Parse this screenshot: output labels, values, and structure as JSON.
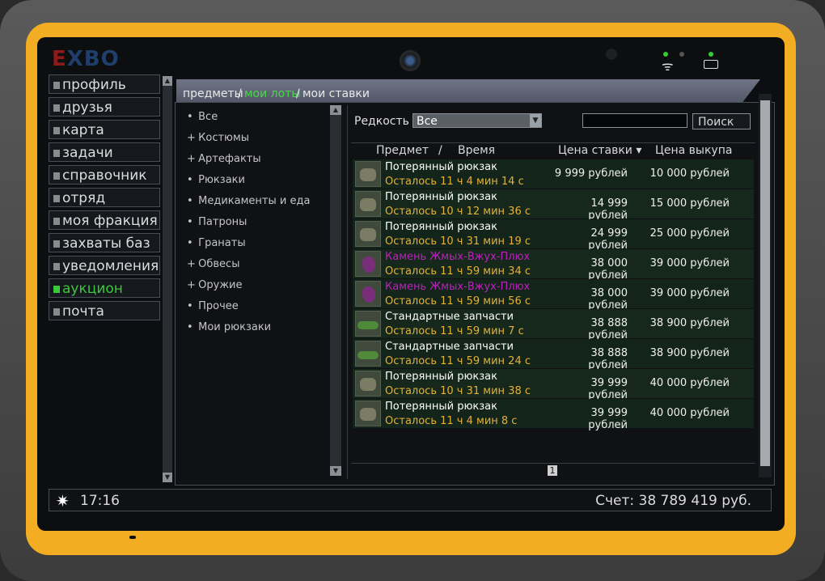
{
  "logo": {
    "text_r": "E",
    "text_rest": "XBO"
  },
  "menu": {
    "items": [
      {
        "label": "профиль",
        "active": false
      },
      {
        "label": "друзья",
        "active": false
      },
      {
        "label": "карта",
        "active": false
      },
      {
        "label": "задачи",
        "active": false
      },
      {
        "label": "справочник",
        "active": false
      },
      {
        "label": "отряд",
        "active": false
      },
      {
        "label": "моя фракция",
        "active": false
      },
      {
        "label": "захваты баз",
        "active": false
      },
      {
        "label": "уведомления",
        "active": false
      },
      {
        "label": "аукцион",
        "active": true
      },
      {
        "label": "почта",
        "active": false
      }
    ]
  },
  "tabs": {
    "items": "предметы",
    "lots": "мои лоты",
    "bids": "мои ставки",
    "sep": "/"
  },
  "categories": [
    {
      "prefix": "•",
      "label": "Все"
    },
    {
      "prefix": "+",
      "label": "Костюмы"
    },
    {
      "prefix": "+",
      "label": "Артефакты"
    },
    {
      "prefix": "•",
      "label": "Рюкзаки"
    },
    {
      "prefix": "•",
      "label": "Медикаменты и еда"
    },
    {
      "prefix": "•",
      "label": "Патроны"
    },
    {
      "prefix": "•",
      "label": "Гранаты"
    },
    {
      "prefix": "+",
      "label": "Обвесы"
    },
    {
      "prefix": "+",
      "label": "Оружие"
    },
    {
      "prefix": "•",
      "label": "Прочее"
    },
    {
      "prefix": "•",
      "label": "Мои рюкзаки"
    }
  ],
  "filter": {
    "rarity_label": "Редкость",
    "rarity_value": "Все",
    "search_button": "Поиск",
    "search_value": ""
  },
  "table": {
    "headers": {
      "item": "Предмет",
      "sep": "/",
      "time": "Время",
      "bid": "Цена ставки ▾",
      "buyout": "Цена выкупа"
    },
    "rows": [
      {
        "icon": "backpack-icon",
        "name": "Потерянный рюкзак",
        "name_color": "white",
        "time": "Осталось 11 ч 4 мин 14 с",
        "bid": "9 999 рублей",
        "buyout": "10 000 рублей"
      },
      {
        "icon": "backpack-icon",
        "name": "Потерянный рюкзак",
        "name_color": "white",
        "time": "Осталось 10 ч 12 мин 36 с",
        "bid": "14 999 рублей",
        "buyout": "15 000 рублей"
      },
      {
        "icon": "backpack-icon",
        "name": "Потерянный рюкзак",
        "name_color": "white",
        "time": "Осталось 10 ч 31 мин 19 с",
        "bid": "24 999 рублей",
        "buyout": "25 000 рублей"
      },
      {
        "icon": "stone-icon",
        "name": "Камень Жмых-Вжух-Плюх",
        "name_color": "magenta",
        "time": "Осталось 11 ч 59 мин 34 с",
        "bid": "38 000 рублей",
        "buyout": "39 000 рублей"
      },
      {
        "icon": "stone-icon",
        "name": "Камень Жмых-Вжух-Плюх",
        "name_color": "magenta",
        "time": "Осталось 11 ч 59 мин 56 с",
        "bid": "38 000 рублей",
        "buyout": "39 000 рублей"
      },
      {
        "icon": "parts-icon",
        "name": "Стандартные запчасти",
        "name_color": "white",
        "time": "Осталось 11 ч 59 мин 7 с",
        "bid": "38 888 рублей",
        "buyout": "38 900 рублей"
      },
      {
        "icon": "parts-icon",
        "name": "Стандартные запчасти",
        "name_color": "white",
        "time": "Осталось 11 ч 59 мин 24 с",
        "bid": "38 888 рублей",
        "buyout": "38 900 рублей"
      },
      {
        "icon": "backpack-icon",
        "name": "Потерянный рюкзак",
        "name_color": "white",
        "time": "Осталось 10 ч 31 мин 38 с",
        "bid": "39 999 рублей",
        "buyout": "40 000 рублей"
      },
      {
        "icon": "backpack-icon",
        "name": "Потерянный рюкзак",
        "name_color": "white",
        "time": "Осталось 11 ч 4 мин 8 с",
        "bid": "39 999 рублей",
        "buyout": "40 000 рублей"
      }
    ],
    "page": "1"
  },
  "status": {
    "time": "17:16",
    "balance": "Счет: 38 789 419 руб."
  },
  "colors": {
    "accent_green": "#3cc83c",
    "time_gold": "#e2b23a",
    "rare_magenta": "#c01fc0",
    "frame_yellow": "#f2ad22"
  }
}
